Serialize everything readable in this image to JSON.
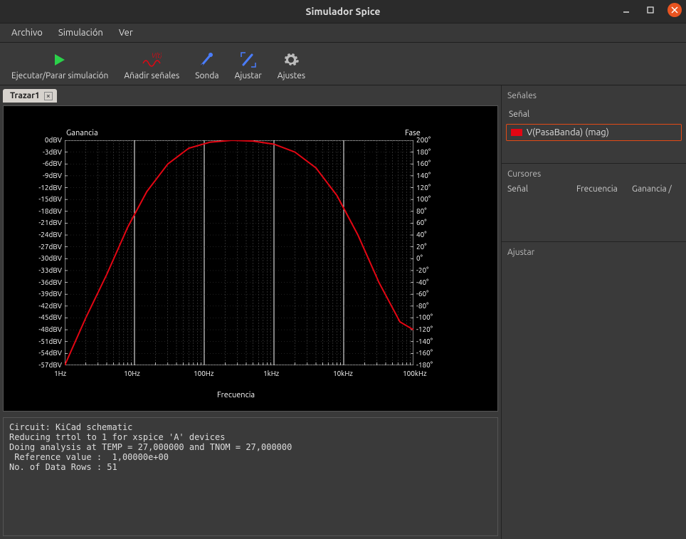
{
  "window": {
    "title": "Simulador Spice"
  },
  "menu": {
    "archivo": "Archivo",
    "simulacion": "Simulación",
    "ver": "Ver"
  },
  "toolbar": {
    "run": "Ejecutar/Parar simulación",
    "add_signals": "Añadir señales",
    "probe": "Sonda",
    "fit": "Ajustar",
    "settings": "Ajustes"
  },
  "tabs": {
    "tab1": "Trazar1"
  },
  "plot": {
    "gain_label": "Ganancia",
    "phase_label": "Fase",
    "xlabel": "Frecuencia",
    "y1_ticks": [
      "0dBV",
      "-3dBV",
      "-6dBV",
      "-9dBV",
      "-12dBV",
      "-15dBV",
      "-18dBV",
      "-21dBV",
      "-24dBV",
      "-27dBV",
      "-30dBV",
      "-33dBV",
      "-36dBV",
      "-39dBV",
      "-42dBV",
      "-45dBV",
      "-48dBV",
      "-51dBV",
      "-54dBV",
      "-57dBV"
    ],
    "y2_ticks": [
      "200°",
      "180°",
      "160°",
      "140°",
      "120°",
      "100°",
      "80°",
      "60°",
      "40°",
      "20°",
      "0°",
      "-20°",
      "-40°",
      "-60°",
      "-80°",
      "-100°",
      "-120°",
      "-140°",
      "-160°",
      "-180°"
    ],
    "x_ticks": [
      "1Hz",
      "10Hz",
      "100Hz",
      "1kHz",
      "10kHz",
      "100kHz"
    ]
  },
  "chart_data": {
    "type": "line",
    "title": "",
    "xlabel": "Frecuencia",
    "ylabel_left": "Ganancia (dBV)",
    "ylabel_right": "Fase (°)",
    "x_scale": "log",
    "x_range_hz": [
      1,
      100000
    ],
    "y_left_range_db": [
      -57,
      0
    ],
    "y_right_range_deg": [
      -180,
      200
    ],
    "x_tick_values_hz": [
      1,
      10,
      100,
      1000,
      10000,
      100000
    ],
    "series": [
      {
        "name": "V(PasaBanda) (mag)",
        "color": "#e30613",
        "axis": "left",
        "x_hz": [
          1,
          2,
          4,
          8,
          15,
          30,
          60,
          120,
          250,
          500,
          1000,
          2000,
          4000,
          8000,
          16000,
          32000,
          64000,
          100000
        ],
        "y_dBV": [
          -57,
          -45,
          -34,
          -22,
          -13,
          -6,
          -2,
          -0.5,
          0,
          -0.2,
          -1,
          -3,
          -7,
          -14,
          -24,
          -36,
          -46,
          -48
        ]
      }
    ]
  },
  "console": {
    "text": "Circuit: KiCad schematic\nReducing trtol to 1 for xspice 'A' devices\nDoing analysis at TEMP = 27,000000 and TNOM = 27,000000\n Reference value :  1,00000e+00\nNo. of Data Rows : 51"
  },
  "right": {
    "signals_title": "Señales",
    "signal_col": "Señal",
    "signal_item": "V(PasaBanda) (mag)",
    "cursors_title": "Cursores",
    "cursor_col_signal": "Señal",
    "cursor_col_freq": "Frecuencia",
    "cursor_col_gain": "Ganancia /",
    "tune_title": "Ajustar"
  }
}
